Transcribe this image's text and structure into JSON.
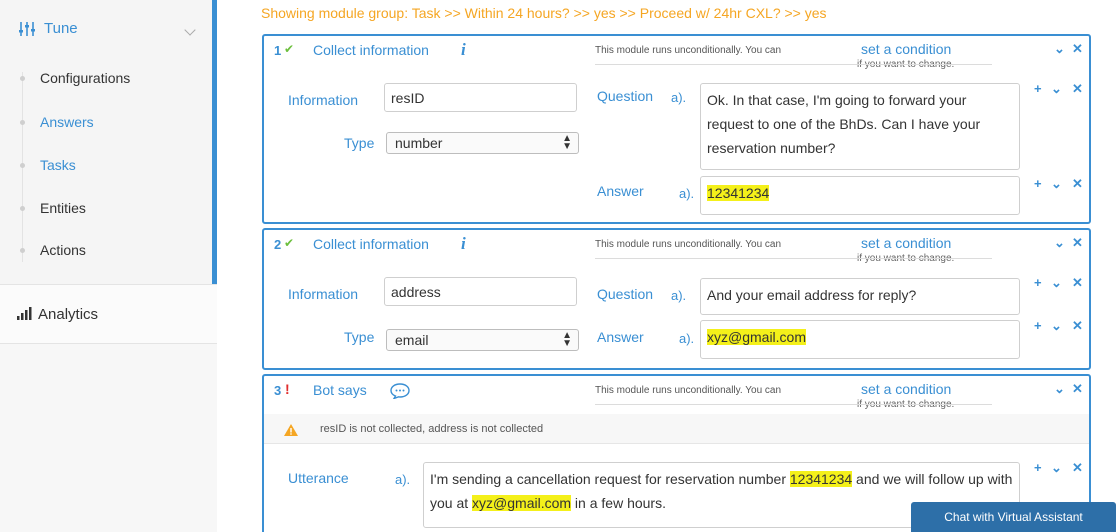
{
  "sidebar": {
    "tune_label": "Tune",
    "items": [
      {
        "label": "Configurations",
        "active": false
      },
      {
        "label": "Answers",
        "active": true
      },
      {
        "label": "Tasks",
        "active": true
      },
      {
        "label": "Entities",
        "active": false
      },
      {
        "label": "Actions",
        "active": false
      }
    ],
    "analytics_label": "Analytics"
  },
  "breadcrumb": "Showing module group:  Task  >> Within 24 hours?  >> yes  >> Proceed w/ 24hr CXL?  >> yes",
  "condition": {
    "text": "This module runs unconditionally. You can",
    "link": "set a condition",
    "sub": "if you want to change."
  },
  "controls": {
    "move": "✓",
    "close": "✕",
    "add": "+"
  },
  "modules": [
    {
      "num": "1",
      "status": "✔",
      "title": "Collect information",
      "info_label": "Information",
      "info_value": "resID",
      "type_label": "Type",
      "type_value": "number",
      "question_label": "Question",
      "question_letter": "a).",
      "question_text": "Ok. In that case, I'm going to forward your request to one of the BhDs.  Can I have your reservation number?",
      "answer_label": "Answer",
      "answer_letter": "a).",
      "answer_value": "12341234"
    },
    {
      "num": "2",
      "status": "✔",
      "title": "Collect information",
      "info_label": "Information",
      "info_value": "address",
      "type_label": "Type",
      "type_value": "email",
      "question_label": "Question",
      "question_letter": "a).",
      "question_text": "And your email address for reply?",
      "answer_label": "Answer",
      "answer_letter": "a).",
      "answer_value": "xyz@gmail.com"
    },
    {
      "num": "3",
      "status": "!",
      "title": "Bot says",
      "warning": "resID is not collected, address is not collected",
      "utterance_label": "Utterance",
      "utterance_letter": "a).",
      "utt_part1": "I'm sending a cancellation request for reservation number ",
      "utt_hl1": "12341234",
      "utt_part2": " and we will follow up with you at ",
      "utt_hl2": "xyz@gmail.com",
      "utt_part3": " in a few hours."
    }
  ],
  "chat_button": "Chat with Virtual Assistant",
  "colors": {
    "accent": "#3a8fd3",
    "breadcrumb": "#f5a623",
    "highlight": "#f4f01a",
    "check": "#6cbf3d",
    "error": "#e02d2d",
    "chat": "#2d6fa8"
  }
}
